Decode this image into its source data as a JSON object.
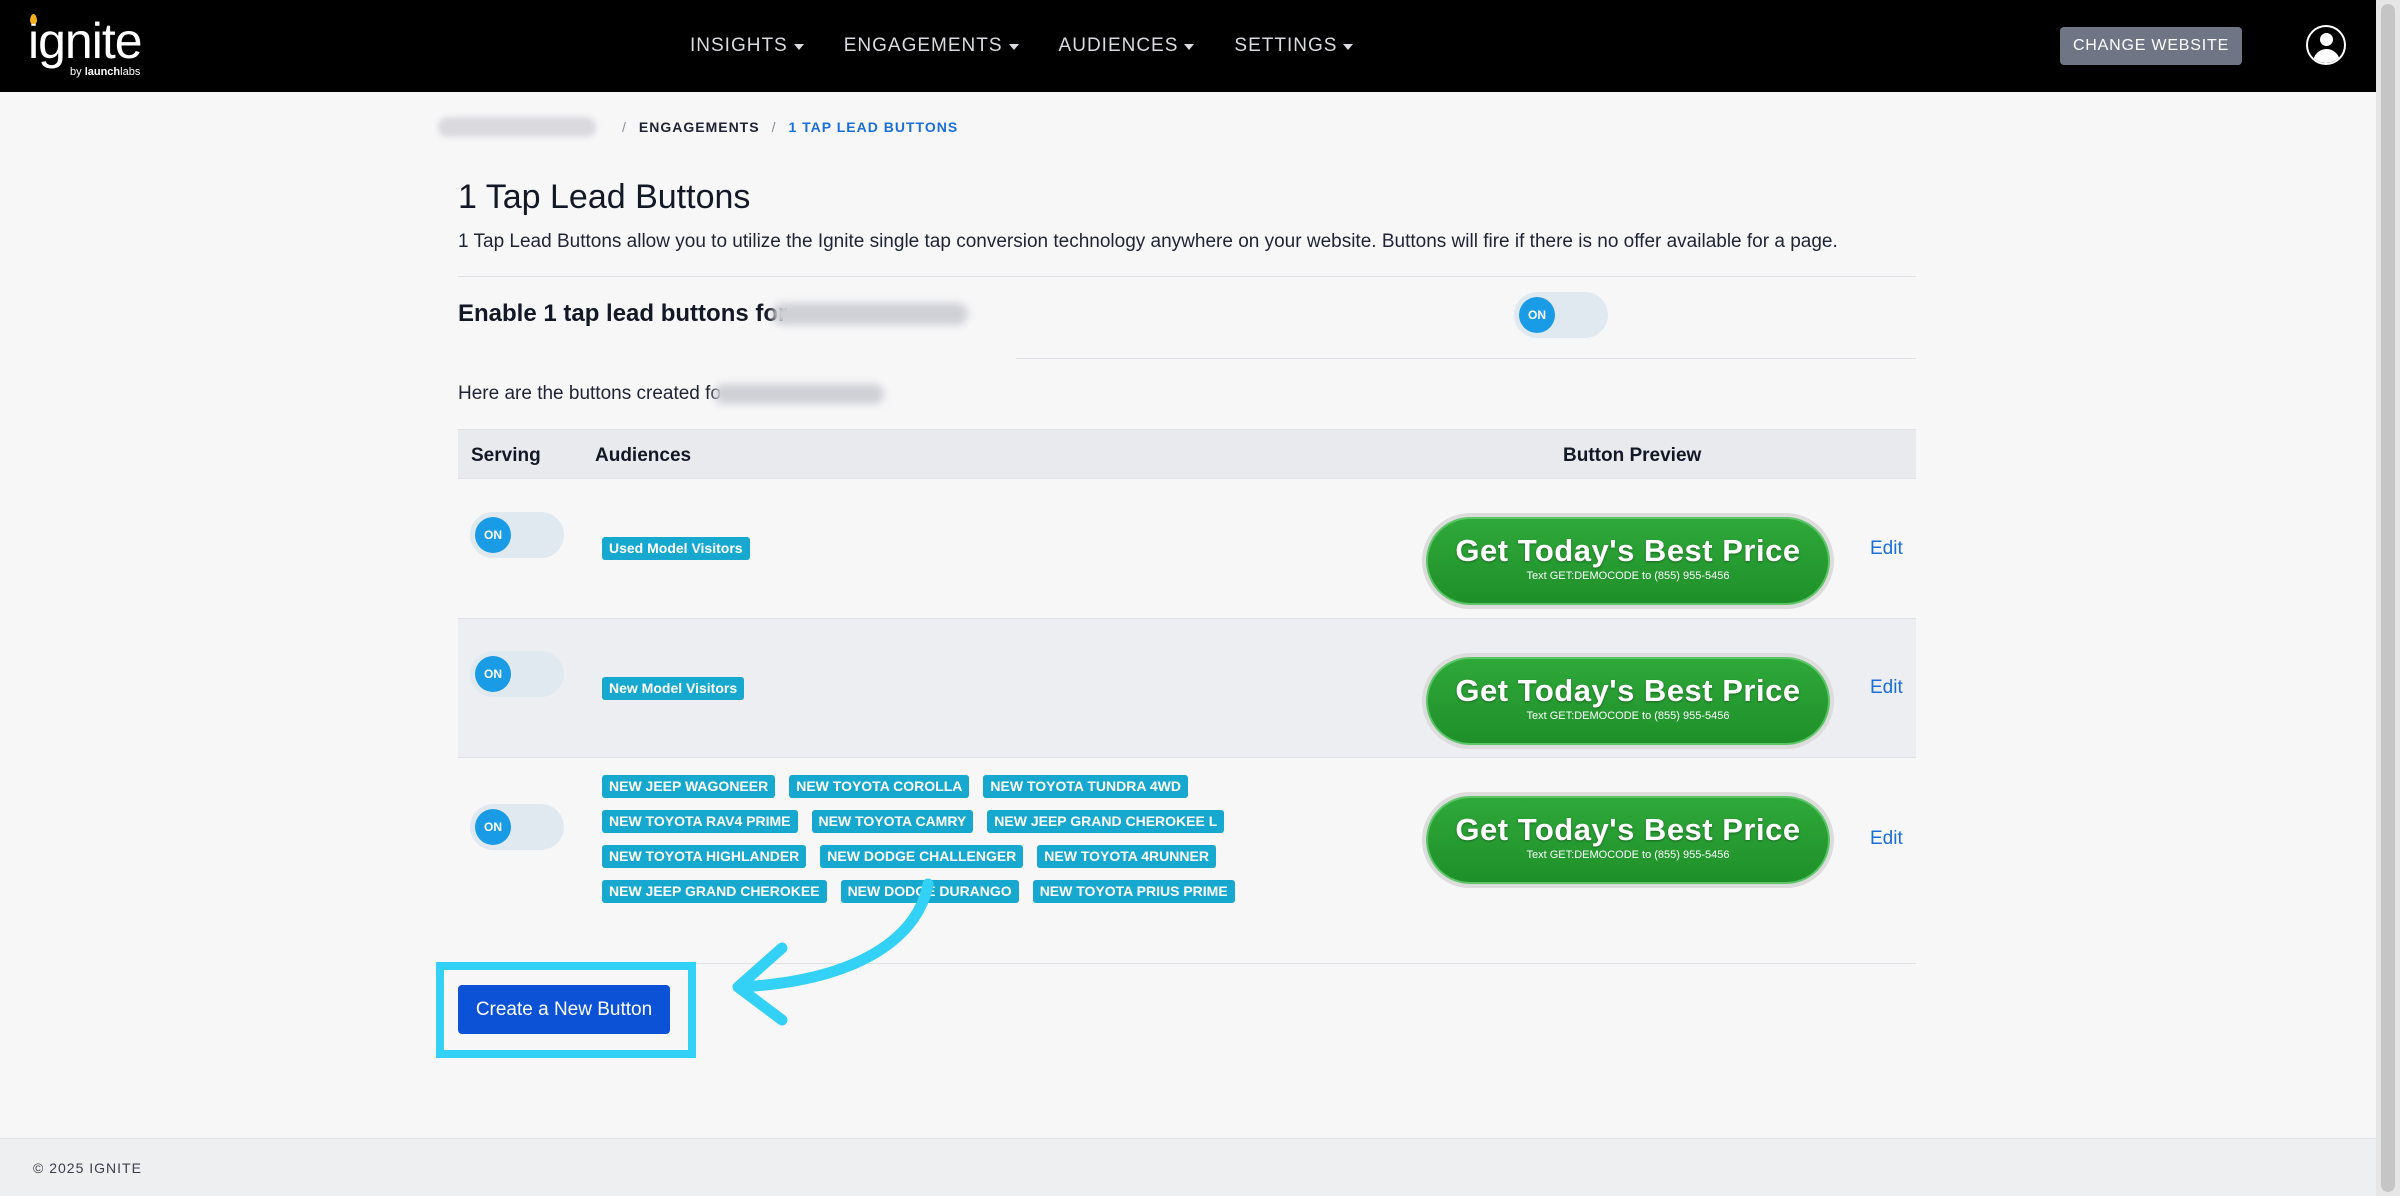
{
  "brand": {
    "name": "ignite",
    "sub_prefix": "by ",
    "sub_bold": "launch",
    "sub_suffix": "labs"
  },
  "nav": {
    "items": [
      "INSIGHTS",
      "ENGAGEMENTS",
      "AUDIENCES",
      "SETTINGS"
    ]
  },
  "header": {
    "change_website": "CHANGE WEBSITE"
  },
  "breadcrumb": {
    "engagements": "ENGAGEMENTS",
    "current": "1 TAP LEAD BUTTONS",
    "sep": "/"
  },
  "page": {
    "title": "1 Tap Lead Buttons",
    "description": "1 Tap Lead Buttons allow you to utilize the Ignite single tap conversion technology anywhere on your website. Buttons will fire if there is no offer available for a page.",
    "enable_label": "Enable 1 tap lead buttons for",
    "enable_toggle": "ON",
    "here_text": "Here are the buttons created fo"
  },
  "table": {
    "headers": {
      "serving": "Serving",
      "audiences": "Audiences",
      "preview": "Button Preview"
    },
    "rows": [
      {
        "toggle": "ON",
        "tags": [
          "Used Model Visitors"
        ],
        "cta_main": "Get Today's Best Price",
        "cta_sub": "Text GET:DEMOCODE to (855) 955-5456",
        "edit": "Edit"
      },
      {
        "toggle": "ON",
        "tags": [
          "New Model Visitors"
        ],
        "cta_main": "Get Today's Best Price",
        "cta_sub": "Text GET:DEMOCODE to (855) 955-5456",
        "edit": "Edit"
      },
      {
        "toggle": "ON",
        "tags": [
          "NEW JEEP WAGONEER",
          "NEW TOYOTA COROLLA",
          "NEW TOYOTA TUNDRA 4WD",
          "NEW TOYOTA RAV4 PRIME",
          "NEW TOYOTA CAMRY",
          "NEW JEEP GRAND CHEROKEE L",
          "NEW TOYOTA HIGHLANDER",
          "NEW DODGE CHALLENGER",
          "NEW TOYOTA 4RUNNER",
          "NEW JEEP GRAND CHEROKEE",
          "NEW DODGE DURANGO",
          "NEW TOYOTA PRIUS PRIME"
        ],
        "cta_main": "Get Today's Best Price",
        "cta_sub": "Text GET:DEMOCODE to (855) 955-5456",
        "edit": "Edit"
      }
    ]
  },
  "actions": {
    "create": "Create a New Button"
  },
  "footer": {
    "copyright": "© 2025 IGNITE"
  },
  "colors": {
    "accent": "#0b52d6",
    "tag": "#17a8cf",
    "cta_green": "#1f9029",
    "highlight": "#33d1f5",
    "toggle_on": "#1a9be6"
  }
}
